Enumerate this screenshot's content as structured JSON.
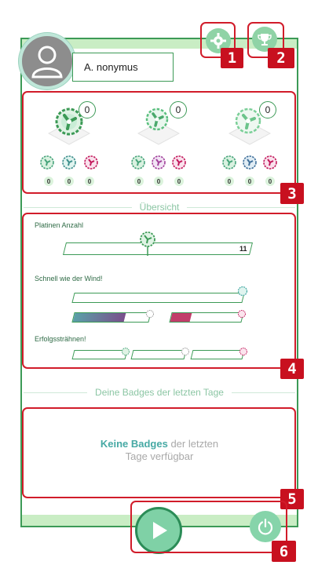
{
  "user": {
    "name": "A. nonymus"
  },
  "header": {
    "settings_icon": "gear-icon",
    "trophy_icon": "trophy-icon",
    "markers": {
      "settings": "1",
      "trophy": "2"
    }
  },
  "gears": {
    "marker": "3",
    "columns": [
      {
        "count": "0",
        "small_counts": [
          "0",
          "0",
          "0"
        ]
      },
      {
        "count": "0",
        "small_counts": [
          "0",
          "0",
          "0"
        ]
      },
      {
        "count": "0",
        "small_counts": [
          "0",
          "0",
          "0"
        ]
      }
    ]
  },
  "overview": {
    "title": "Übersicht",
    "marker": "4",
    "platinen": {
      "label": "Platinen Anzahl",
      "value": "11"
    },
    "wind": {
      "label": "Schnell wie der Wind!"
    },
    "streak": {
      "label": "Erfolgssträhnen!"
    }
  },
  "badges": {
    "title": "Deine Badges der letzten Tage",
    "empty_strong": "Keine Badges",
    "empty_rest_1": " der letzten",
    "empty_rest_2": "Tage verfügbar",
    "marker": "5"
  },
  "footer": {
    "play_icon": "play-icon",
    "power_icon": "power-icon",
    "marker": "6"
  },
  "colors": {
    "accent": "#3c9a56",
    "highlight": "#d11c2a",
    "mint": "#c9edc4",
    "teal": "#46a9a4",
    "magenta": "#c2185b"
  }
}
